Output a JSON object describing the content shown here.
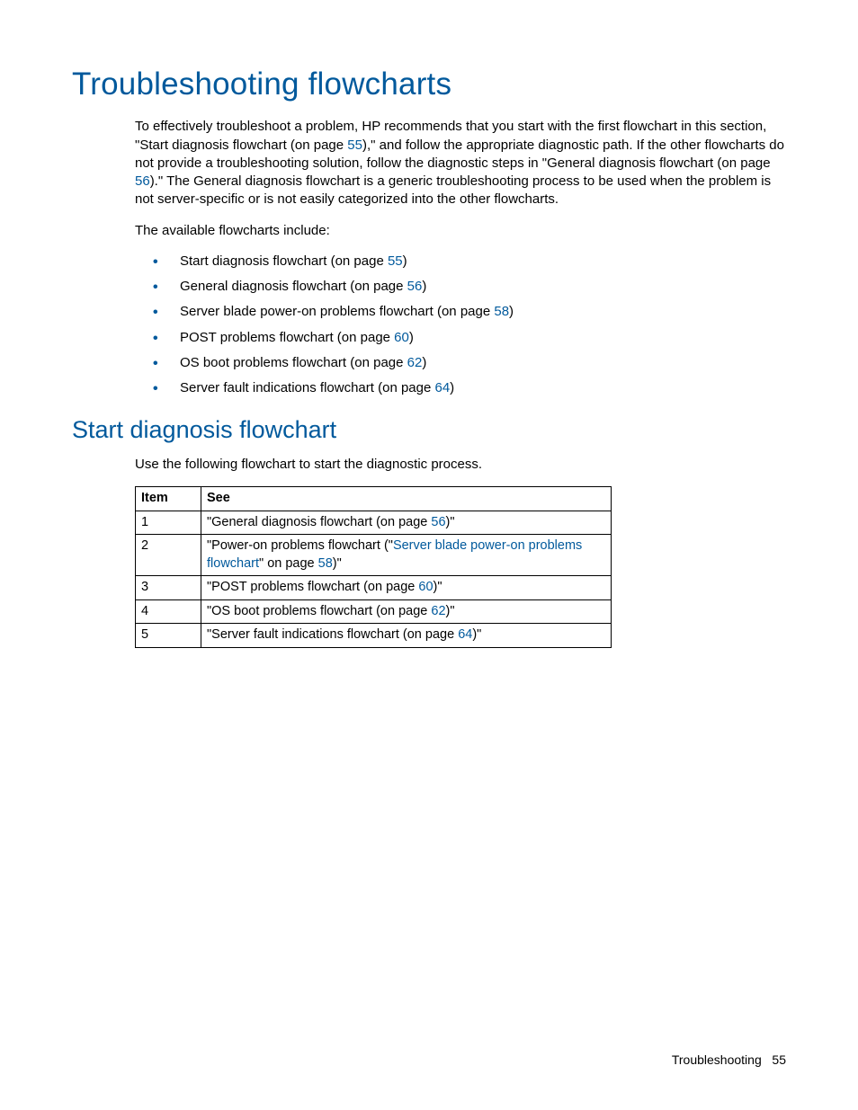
{
  "h1": "Troubleshooting flowcharts",
  "intro": {
    "p1a": "To effectively troubleshoot a problem, HP recommends that you start with the first flowchart in this section, \"Start diagnosis flowchart (on page ",
    "p1_link1": "55",
    "p1b": "),\" and follow the appropriate diagnostic path. If the other flowcharts do not provide a troubleshooting solution, follow the diagnostic steps in \"General diagnosis flowchart (on page ",
    "p1_link2": "56",
    "p1c": ").\" The General diagnosis flowchart is a generic troubleshooting process to be used when the problem is not server-specific or is not easily categorized into the other flowcharts.",
    "p2": "The available flowcharts include:"
  },
  "bullets": [
    {
      "pre": "Start diagnosis flowchart (on page ",
      "link": "55",
      "post": ")"
    },
    {
      "pre": "General diagnosis flowchart (on page ",
      "link": "56",
      "post": ")"
    },
    {
      "pre": "Server blade power-on problems flowchart (on page ",
      "link": "58",
      "post": ")"
    },
    {
      "pre": "POST problems flowchart (on page ",
      "link": "60",
      "post": ")"
    },
    {
      "pre": "OS boot problems flowchart (on page ",
      "link": "62",
      "post": ")"
    },
    {
      "pre": "Server fault indications flowchart (on page ",
      "link": "64",
      "post": ")"
    }
  ],
  "h2": "Start diagnosis flowchart",
  "sub_p": "Use the following flowchart to start the diagnostic process.",
  "table": {
    "h_item": "Item",
    "h_see": "See",
    "rows": [
      {
        "n": "1",
        "pre": "\"General diagnosis flowchart (on page ",
        "link": "56",
        "post": ")\""
      },
      {
        "n": "2",
        "pre": "\"Power-on problems flowchart (\"",
        "link": "Server blade power-on problems flowchart",
        "mid": "\" on page ",
        "link2": "58",
        "post": ")\""
      },
      {
        "n": "3",
        "pre": "\"POST problems flowchart (on page ",
        "link": "60",
        "post": ")\""
      },
      {
        "n": "4",
        "pre": "\"OS boot problems flowchart (on page ",
        "link": "62",
        "post": ")\""
      },
      {
        "n": "5",
        "pre": "\"Server fault indications flowchart (on page ",
        "link": "64",
        "post": ")\""
      }
    ]
  },
  "footer": {
    "label": "Troubleshooting",
    "page": "55"
  }
}
